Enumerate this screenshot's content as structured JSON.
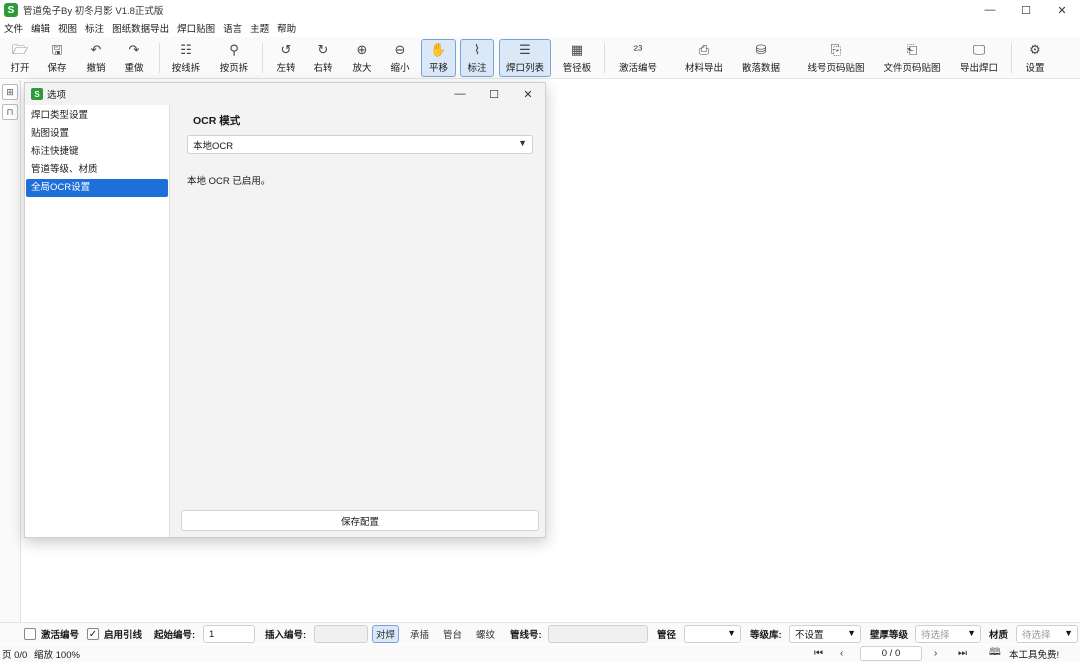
{
  "app": {
    "title": "管道兔子By 初冬月影 V1.8正式版",
    "icon": "S"
  },
  "window_controls": {
    "minimize": "—",
    "maximize": "☐",
    "close": "✕"
  },
  "menu": [
    "文件",
    "编辑",
    "视图",
    "标注",
    "图纸数据导出",
    "焊口贴图",
    "语言",
    "主题",
    "帮助"
  ],
  "toolbar": [
    {
      "label": "打开",
      "icon": "folder-open-icon",
      "glyph": "🗁"
    },
    {
      "label": "保存",
      "icon": "save-icon",
      "glyph": "🖫"
    },
    {
      "label": "撤销",
      "icon": "undo-icon",
      "glyph": "↶"
    },
    {
      "label": "重做",
      "icon": "redo-icon",
      "glyph": "↷"
    },
    {
      "label": "按线拆",
      "icon": "split-line-icon",
      "glyph": "☷"
    },
    {
      "label": "按页拆",
      "icon": "split-page-icon",
      "glyph": "⚲"
    },
    {
      "label": "左转",
      "icon": "rotate-left-icon",
      "glyph": "↺"
    },
    {
      "label": "右转",
      "icon": "rotate-right-icon",
      "glyph": "↻"
    },
    {
      "label": "放大",
      "icon": "zoom-in-icon",
      "glyph": "⊕"
    },
    {
      "label": "缩小",
      "icon": "zoom-out-icon",
      "glyph": "⊖"
    },
    {
      "label": "平移",
      "icon": "hand-icon",
      "glyph": "✋"
    },
    {
      "label": "标注",
      "icon": "annotate-icon",
      "glyph": "⌇"
    },
    {
      "label": "焊口列表",
      "icon": "weld-list-icon",
      "glyph": "☰"
    },
    {
      "label": "管径板",
      "icon": "pipe-board-icon",
      "glyph": "▦"
    },
    {
      "label": "激活编号",
      "icon": "activate-number-icon",
      "glyph": "²³"
    },
    {
      "label": "材料导出",
      "icon": "material-export-icon",
      "glyph": "⎙"
    },
    {
      "label": "散落数据",
      "icon": "scatter-data-icon",
      "glyph": "⛁"
    },
    {
      "label": "线号页码贴图",
      "icon": "line-page-map-icon",
      "glyph": "⎘"
    },
    {
      "label": "文件页码贴图",
      "icon": "file-page-map-icon",
      "glyph": "⎗"
    },
    {
      "label": "导出焊口",
      "icon": "export-weld-icon",
      "glyph": "🖵"
    },
    {
      "label": "设置",
      "icon": "gear-icon",
      "glyph": "⚙"
    }
  ],
  "sidebar_icons": [
    {
      "icon": "grid-icon",
      "glyph": "⊞"
    },
    {
      "icon": "bookmark-icon",
      "glyph": "⊓"
    }
  ],
  "dialog": {
    "title": "选项",
    "icon": "S",
    "sections": [
      "焊口类型设置",
      "贴图设置",
      "标注快捷键",
      "管道等级、材质",
      "全局OCR设置"
    ],
    "selected_section": "全局OCR设置",
    "ocr": {
      "heading": "OCR 模式",
      "mode": "本地OCR",
      "status": "本地 OCR 已启用。",
      "save_label": "保存配置"
    }
  },
  "bottombar": {
    "activate_number": {
      "label": "激活编号",
      "checked": false
    },
    "enable_leader": {
      "label": "启用引线",
      "checked": true
    },
    "start_number": {
      "label": "起始编号:",
      "value": "1"
    },
    "insert_number": {
      "label": "插入编号:",
      "value": ""
    },
    "weld_types": [
      "对焊",
      "承插",
      "管台",
      "螺纹"
    ],
    "active_weld_type": "对焊",
    "line_number": {
      "label": "管线号:",
      "value": ""
    },
    "pipe_size": {
      "label": "管径",
      "value": ""
    },
    "grade_lib": {
      "label": "等级库:",
      "value": "不设置"
    },
    "wall_grade": {
      "label": "壁厚等级",
      "placeholder": "待选择"
    },
    "material": {
      "label": "材质",
      "placeholder": "待选择"
    }
  },
  "statusbar": {
    "page": "页 0/0",
    "zoom": "缩放 100%",
    "page_box": "0 / 0",
    "free_notice": "本工具免费!"
  }
}
